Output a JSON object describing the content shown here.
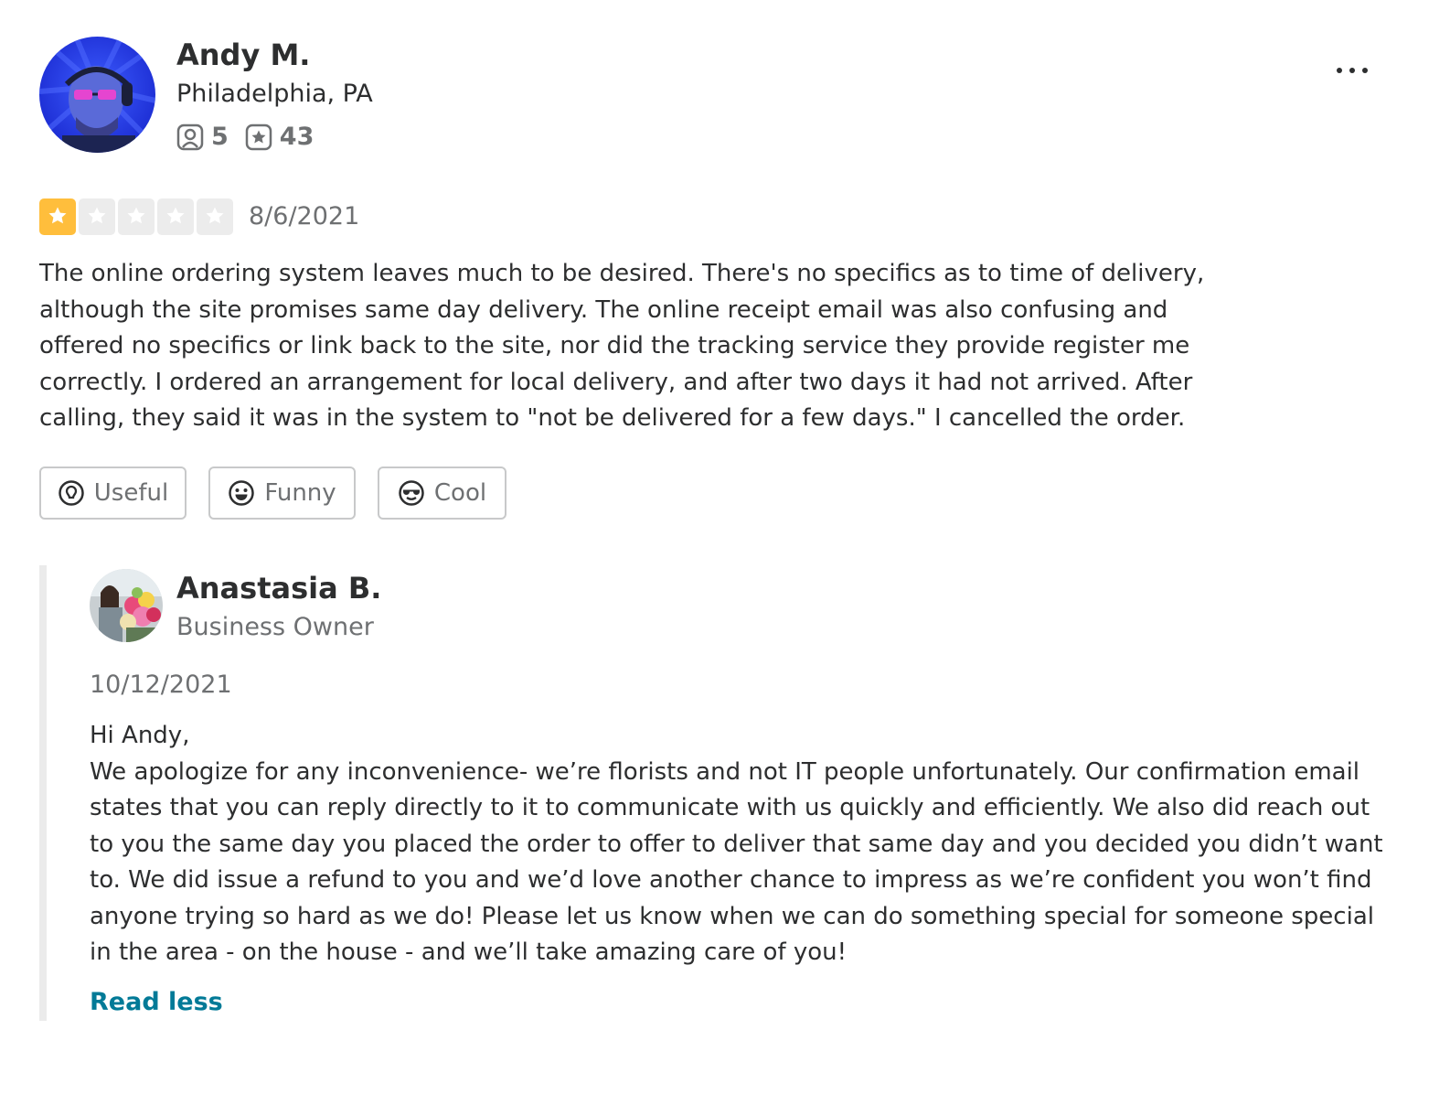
{
  "review": {
    "author": {
      "name": "Andy M.",
      "location": "Philadelphia, PA",
      "friends_count": "5",
      "reviews_count": "43"
    },
    "rating": 1,
    "rating_max": 5,
    "date": "8/6/2021",
    "text": "The online ordering system leaves much to be desired. There's no specifics as to time of delivery, although the site promises same day delivery. The online receipt email was also confusing and offered no specifics or link back to the site, nor did the tracking service they provide register me correctly. I ordered an arrangement for local delivery, and after two days it had not arrived. After calling, they said it was in the system to \"not be delivered for a few days.\" I cancelled the order.",
    "reactions": {
      "useful": "Useful",
      "funny": "Funny",
      "cool": "Cool"
    }
  },
  "reply": {
    "author": {
      "name": "Anastasia B.",
      "role": "Business Owner"
    },
    "date": "10/12/2021",
    "greeting": "Hi Andy,",
    "text": "We apologize for any inconvenience- we’re florists and not IT people unfortunately. Our confirmation email states that you can reply directly to it to communicate with us quickly and efficiently. We also did reach out to you the same day you placed the order to offer to deliver that same day and you decided you didn’t want to. We did issue a refund to you and we’d love another chance to impress as we’re confident you won’t find anyone trying so hard as we do! Please let us know when we can do something special for someone special in the area - on the house - and we’ll take amazing care of you!",
    "toggle_label": "Read less"
  },
  "colors": {
    "star_filled": "#ffbe3c",
    "star_empty": "#ececec",
    "link": "#027a97",
    "text": "#2d2e2f",
    "muted": "#6e7072"
  },
  "icons": {
    "friends": "friends-icon",
    "reviews": "review-star-icon",
    "more": "more-options-icon",
    "useful": "lightbulb-icon",
    "funny": "smile-icon",
    "cool": "sunglasses-icon"
  }
}
